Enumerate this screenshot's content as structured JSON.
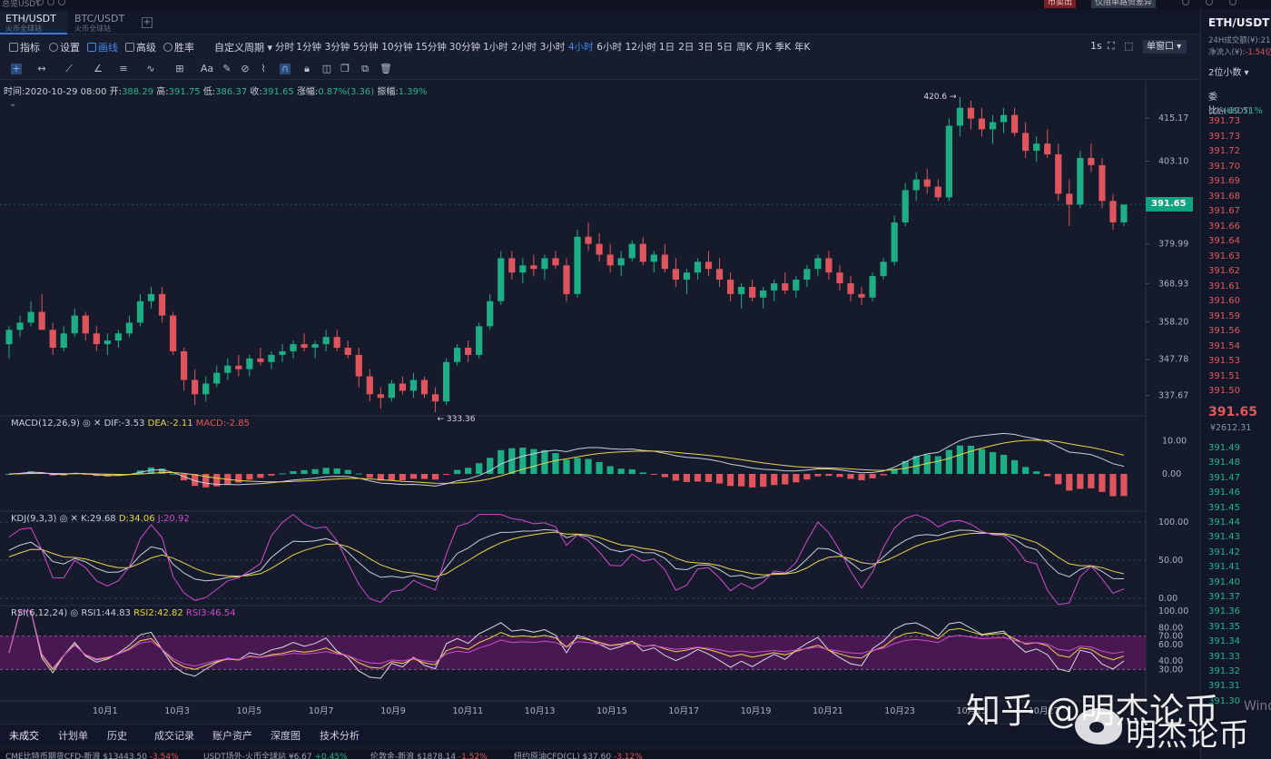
{
  "topbar": {
    "brand": "总览USDT",
    "sell_label": "币卖出",
    "account_label": "仅阻单路资差异"
  },
  "tabs": [
    {
      "pair": "ETH/USDT",
      "exchange": "火币全球站",
      "active": true
    },
    {
      "pair": "BTC/USDT",
      "exchange": "火币全球站",
      "active": false
    }
  ],
  "toolbar": {
    "indicators": "指标",
    "settings": "设置",
    "draw": "画线",
    "advanced": "高级",
    "winrate": "胜率",
    "custom_period": "自定义周期",
    "periods": [
      "分时",
      "1分钟",
      "3分钟",
      "5分钟",
      "10分钟",
      "15分钟",
      "30分钟",
      "1小时",
      "2小时",
      "3小时",
      "4小时",
      "6小时",
      "12小时",
      "1日",
      "2日",
      "3日",
      "5日",
      "周K",
      "月K",
      "季K",
      "年K"
    ],
    "active_period": "4小时",
    "interval_1s": "1s",
    "single_window": "单窗口"
  },
  "info": {
    "time_label": "时间:",
    "time": "2020-10-29 08:00",
    "open_label": "开:",
    "open": "388.29",
    "high_label": "高:",
    "high": "391.75",
    "low_label": "低:",
    "low": "386.37",
    "close_label": "收:",
    "close": "391.65",
    "chg_label": "涨幅:",
    "chg": "0.87%(3.36)",
    "amp_label": "振幅:",
    "amp": "1.39%"
  },
  "macd": {
    "name": "MACD(12,26,9)",
    "dif": "DIF:-3.53",
    "dea": "DEA:-2.11",
    "macd": "MACD:-2.85"
  },
  "kdj": {
    "name": "KDJ(9,3,3)",
    "k": "K:29.68",
    "d": "D:34.06",
    "j": "J:20.92"
  },
  "rsi": {
    "name": "RSI(6,12,24)",
    "rsi1": "RSI1:44.83",
    "rsi2": "RSI2:42.82",
    "rsi3": "RSI3:46.54"
  },
  "price_axis": [
    "415.17",
    "403.10",
    "379.99",
    "368.93",
    "358.20",
    "347.78",
    "337.67"
  ],
  "current_price": "391.65",
  "high_marker": "420.6",
  "low_marker": "333.36",
  "macd_axis": [
    "10.00",
    "0.00"
  ],
  "kdj_axis": [
    "100.00",
    "50.00",
    "0.00"
  ],
  "rsi_axis": [
    "100.00",
    "80.00",
    "70.00",
    "60.00",
    "40.00",
    "30.00"
  ],
  "x_labels": [
    "10月1",
    "10月3",
    "10月5",
    "10月7",
    "10月9",
    "10月11",
    "10月13",
    "10月15",
    "10月17",
    "10月19",
    "10月21",
    "10月23",
    "10月25",
    "10月27"
  ],
  "bottom_tabs": [
    "未成交",
    "计划单",
    "历史",
    "成交记录",
    "账户资产",
    "深度图",
    "技术分析"
  ],
  "ticker": [
    {
      "name": "CME比特币期货CFD-新浪",
      "price": "$13443.50",
      "chg": "-3.54%",
      "dir": "down"
    },
    {
      "name": "USDT场外-火币全球站",
      "price": "¥6.67",
      "chg": "+0.45%",
      "dir": "up"
    },
    {
      "name": "伦敦金-新浪",
      "price": "$1878.14",
      "chg": "-1.52%",
      "dir": "down"
    },
    {
      "name": "纽约原油CFD(CL)",
      "price": "$37.60",
      "chg": "-3.12%",
      "dir": "down"
    }
  ],
  "right_panel": {
    "pair": "ETH/USDT",
    "vol_label": "24H成交额(¥):",
    "vol": "21",
    "flow_label": "净流入(¥):",
    "flow": "-1.54亿",
    "decimals": "2位小数",
    "ratio_label": "委比:",
    "ratio": "+69.51%",
    "price_header": "价格(USDT)",
    "asks": [
      "391.73",
      "391.73",
      "391.72",
      "391.70",
      "391.69",
      "391.68",
      "391.67",
      "391.66",
      "391.64",
      "391.63",
      "391.62",
      "391.61",
      "391.60",
      "391.59",
      "391.56",
      "391.54",
      "391.53",
      "391.51",
      "391.50"
    ],
    "last": "391.65",
    "last_cny": "¥2612.31",
    "bids": [
      "391.49",
      "391.48",
      "391.47",
      "391.46",
      "391.45",
      "391.44",
      "391.43",
      "391.42",
      "391.41",
      "391.40",
      "391.37",
      "391.36",
      "391.35",
      "391.34",
      "391.33",
      "391.32",
      "391.31",
      "391.30"
    ]
  },
  "watermark": {
    "line1": "知乎 @明杰论币",
    "line2": "明杰论币"
  },
  "windows_watermark": "Windows",
  "chart_data": {
    "type": "candlestick",
    "pair": "ETH/USDT",
    "interval": "4h",
    "ylim": [
      333,
      422
    ],
    "candles": [
      [
        352,
        357,
        348,
        356
      ],
      [
        356,
        360,
        354,
        358
      ],
      [
        358,
        364,
        357,
        361
      ],
      [
        361,
        366,
        359,
        356
      ],
      [
        356,
        358,
        349,
        351
      ],
      [
        351,
        357,
        350,
        355
      ],
      [
        355,
        362,
        354,
        360
      ],
      [
        360,
        361,
        353,
        355
      ],
      [
        355,
        357,
        350,
        352
      ],
      [
        352,
        355,
        349,
        353
      ],
      [
        353,
        356,
        351,
        355
      ],
      [
        355,
        360,
        354,
        358
      ],
      [
        358,
        366,
        357,
        364
      ],
      [
        364,
        368,
        362,
        366
      ],
      [
        366,
        368,
        358,
        360
      ],
      [
        360,
        361,
        349,
        350
      ],
      [
        350,
        351,
        339,
        342
      ],
      [
        342,
        345,
        335,
        338
      ],
      [
        338,
        343,
        336,
        341
      ],
      [
        341,
        346,
        340,
        344
      ],
      [
        344,
        348,
        342,
        346
      ],
      [
        346,
        349,
        343,
        345
      ],
      [
        345,
        349,
        343,
        348
      ],
      [
        348,
        351,
        346,
        347
      ],
      [
        347,
        350,
        345,
        349
      ],
      [
        349,
        352,
        347,
        350
      ],
      [
        350,
        353,
        348,
        352
      ],
      [
        352,
        355,
        350,
        351
      ],
      [
        351,
        353,
        348,
        352
      ],
      [
        352,
        356,
        350,
        354
      ],
      [
        354,
        356,
        350,
        351
      ],
      [
        351,
        353,
        348,
        349
      ],
      [
        349,
        351,
        340,
        343
      ],
      [
        343,
        345,
        336,
        338
      ],
      [
        338,
        340,
        334,
        337
      ],
      [
        337,
        342,
        336,
        341
      ],
      [
        341,
        343,
        338,
        339
      ],
      [
        339,
        344,
        337,
        342
      ],
      [
        342,
        343,
        337,
        338
      ],
      [
        338,
        340,
        333,
        336
      ],
      [
        336,
        348,
        335,
        347
      ],
      [
        347,
        352,
        346,
        351
      ],
      [
        351,
        353,
        347,
        349
      ],
      [
        349,
        358,
        348,
        357
      ],
      [
        357,
        366,
        356,
        364
      ],
      [
        364,
        378,
        363,
        376
      ],
      [
        376,
        378,
        370,
        372
      ],
      [
        372,
        376,
        369,
        374
      ],
      [
        374,
        377,
        371,
        373
      ],
      [
        373,
        377,
        370,
        376
      ],
      [
        376,
        378,
        373,
        374
      ],
      [
        374,
        376,
        364,
        366
      ],
      [
        366,
        384,
        365,
        382
      ],
      [
        382,
        386,
        378,
        380
      ],
      [
        380,
        383,
        375,
        377
      ],
      [
        377,
        380,
        372,
        374
      ],
      [
        374,
        378,
        371,
        376
      ],
      [
        376,
        381,
        375,
        380
      ],
      [
        380,
        382,
        374,
        375
      ],
      [
        375,
        378,
        372,
        377
      ],
      [
        377,
        380,
        372,
        373
      ],
      [
        373,
        376,
        368,
        370
      ],
      [
        370,
        373,
        366,
        372
      ],
      [
        372,
        376,
        370,
        375
      ],
      [
        375,
        378,
        371,
        373
      ],
      [
        373,
        376,
        368,
        370
      ],
      [
        370,
        372,
        364,
        366
      ],
      [
        366,
        369,
        362,
        368
      ],
      [
        368,
        370,
        364,
        365
      ],
      [
        365,
        368,
        362,
        367
      ],
      [
        367,
        370,
        364,
        369
      ],
      [
        369,
        372,
        366,
        367
      ],
      [
        367,
        371,
        365,
        370
      ],
      [
        370,
        374,
        368,
        373
      ],
      [
        373,
        377,
        371,
        376
      ],
      [
        376,
        378,
        370,
        372
      ],
      [
        372,
        374,
        367,
        369
      ],
      [
        369,
        371,
        364,
        366
      ],
      [
        366,
        368,
        363,
        365
      ],
      [
        365,
        372,
        364,
        371
      ],
      [
        371,
        376,
        370,
        375
      ],
      [
        375,
        388,
        374,
        386
      ],
      [
        386,
        397,
        385,
        395
      ],
      [
        395,
        400,
        392,
        398
      ],
      [
        398,
        401,
        394,
        396
      ],
      [
        396,
        398,
        392,
        393
      ],
      [
        393,
        415,
        392,
        413
      ],
      [
        413,
        421,
        410,
        418
      ],
      [
        418,
        420,
        412,
        415
      ],
      [
        415,
        418,
        410,
        412
      ],
      [
        412,
        416,
        408,
        414
      ],
      [
        414,
        418,
        411,
        416
      ],
      [
        416,
        418,
        410,
        411
      ],
      [
        411,
        414,
        404,
        406
      ],
      [
        406,
        410,
        403,
        408
      ],
      [
        408,
        412,
        404,
        405
      ],
      [
        405,
        408,
        392,
        394
      ],
      [
        394,
        398,
        385,
        391
      ],
      [
        391,
        406,
        390,
        404
      ],
      [
        404,
        408,
        400,
        402
      ],
      [
        402,
        404,
        390,
        392
      ],
      [
        392,
        394,
        384,
        386
      ],
      [
        386,
        391,
        385,
        391
      ]
    ]
  }
}
